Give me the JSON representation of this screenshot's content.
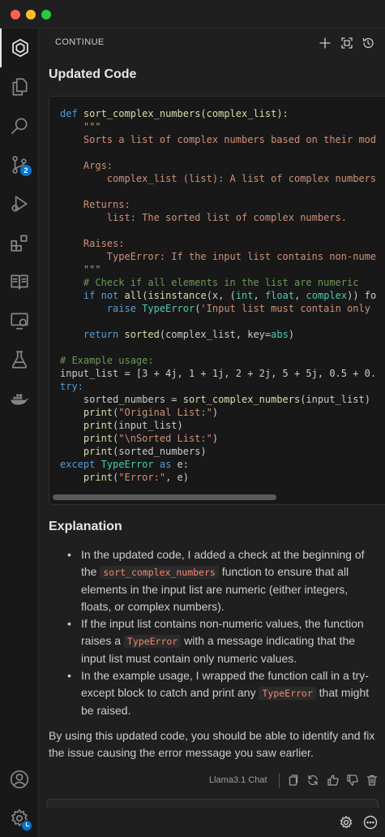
{
  "window": {
    "buttons": [
      "close",
      "minimize",
      "zoom"
    ]
  },
  "activity_bar": {
    "items": [
      {
        "icon": "continue-logo-icon",
        "active": true
      },
      {
        "icon": "explorer-files-icon"
      },
      {
        "icon": "search-icon"
      },
      {
        "icon": "source-control-icon",
        "badge": "2"
      },
      {
        "icon": "run-debug-icon"
      },
      {
        "icon": "extensions-icon"
      },
      {
        "icon": "book-icon"
      },
      {
        "icon": "remote-explorer-icon"
      },
      {
        "icon": "testing-flask-icon"
      },
      {
        "icon": "docker-icon"
      }
    ],
    "bottom": [
      {
        "icon": "account-icon"
      },
      {
        "icon": "manage-gear-icon",
        "badge": "clock"
      }
    ]
  },
  "panel": {
    "title": "CONTINUE",
    "actions": [
      "new-session-plus-icon",
      "fullscreen-icon",
      "history-icon"
    ]
  },
  "message": {
    "heading_code": "Updated Code",
    "code_lines": [
      "def sort_complex_numbers(complex_list):",
      "    \"\"\"",
      "    Sorts a list of complex numbers based on their mod",
      "",
      "    Args:",
      "        complex_list (list): A list of complex numbers",
      "",
      "    Returns:",
      "        list: The sorted list of complex numbers.",
      "",
      "    Raises:",
      "        TypeError: If the input list contains non-nume",
      "    \"\"\"",
      "    # Check if all elements in the list are numeric",
      "    if not all(isinstance(x, (int, float, complex)) fo",
      "        raise TypeError('Input list must contain only",
      "",
      "    return sorted(complex_list, key=abs)",
      "",
      "# Example usage:",
      "input_list = [3 + 4j, 1 + 1j, 2 + 2j, 5 + 5j, 0.5 + 0.",
      "try:",
      "    sorted_numbers = sort_complex_numbers(input_list)",
      "    print(\"Original List:\")",
      "    print(input_list)",
      "    print(\"\\nSorted List:\")",
      "    print(sorted_numbers)",
      "except TypeError as e:",
      "    print(\"Error:\", e)"
    ],
    "heading_explanation": "Explanation",
    "bullets": [
      {
        "before": "In the updated code, I added a check at the beginning of the ",
        "code": "sort_complex_numbers",
        "after": " function to ensure that all elements in the input list are numeric (either integers, floats, or complex numbers)."
      },
      {
        "before": "If the input list contains non-numeric values, the function raises a ",
        "code": "TypeError",
        "after": " with a message indicating that the input list must contain only numeric values."
      },
      {
        "before": "In the example usage, I wrapped the function call in a try-except block to catch and print any ",
        "code": "TypeError",
        "after": " that might be raised."
      }
    ],
    "closing": "By using this updated code, you should be able to identify and fix the issue causing the error message you saw earlier.",
    "model_label": "Llama3.1 Chat",
    "footer_actions": [
      "copy-icon",
      "regenerate-icon",
      "thumbs-up-icon",
      "thumbs-down-icon",
      "delete-icon"
    ]
  },
  "bottom_actions": [
    "settings-gear-icon",
    "more-options-icon"
  ],
  "colors": {
    "background": "#1f1f1f",
    "code_bg": "#181818",
    "keyword": "#569cd6",
    "function": "#dcdcaa",
    "string": "#ce9178",
    "comment": "#6a9955",
    "inline_code": "#f48771",
    "badge": "#0078d4"
  }
}
